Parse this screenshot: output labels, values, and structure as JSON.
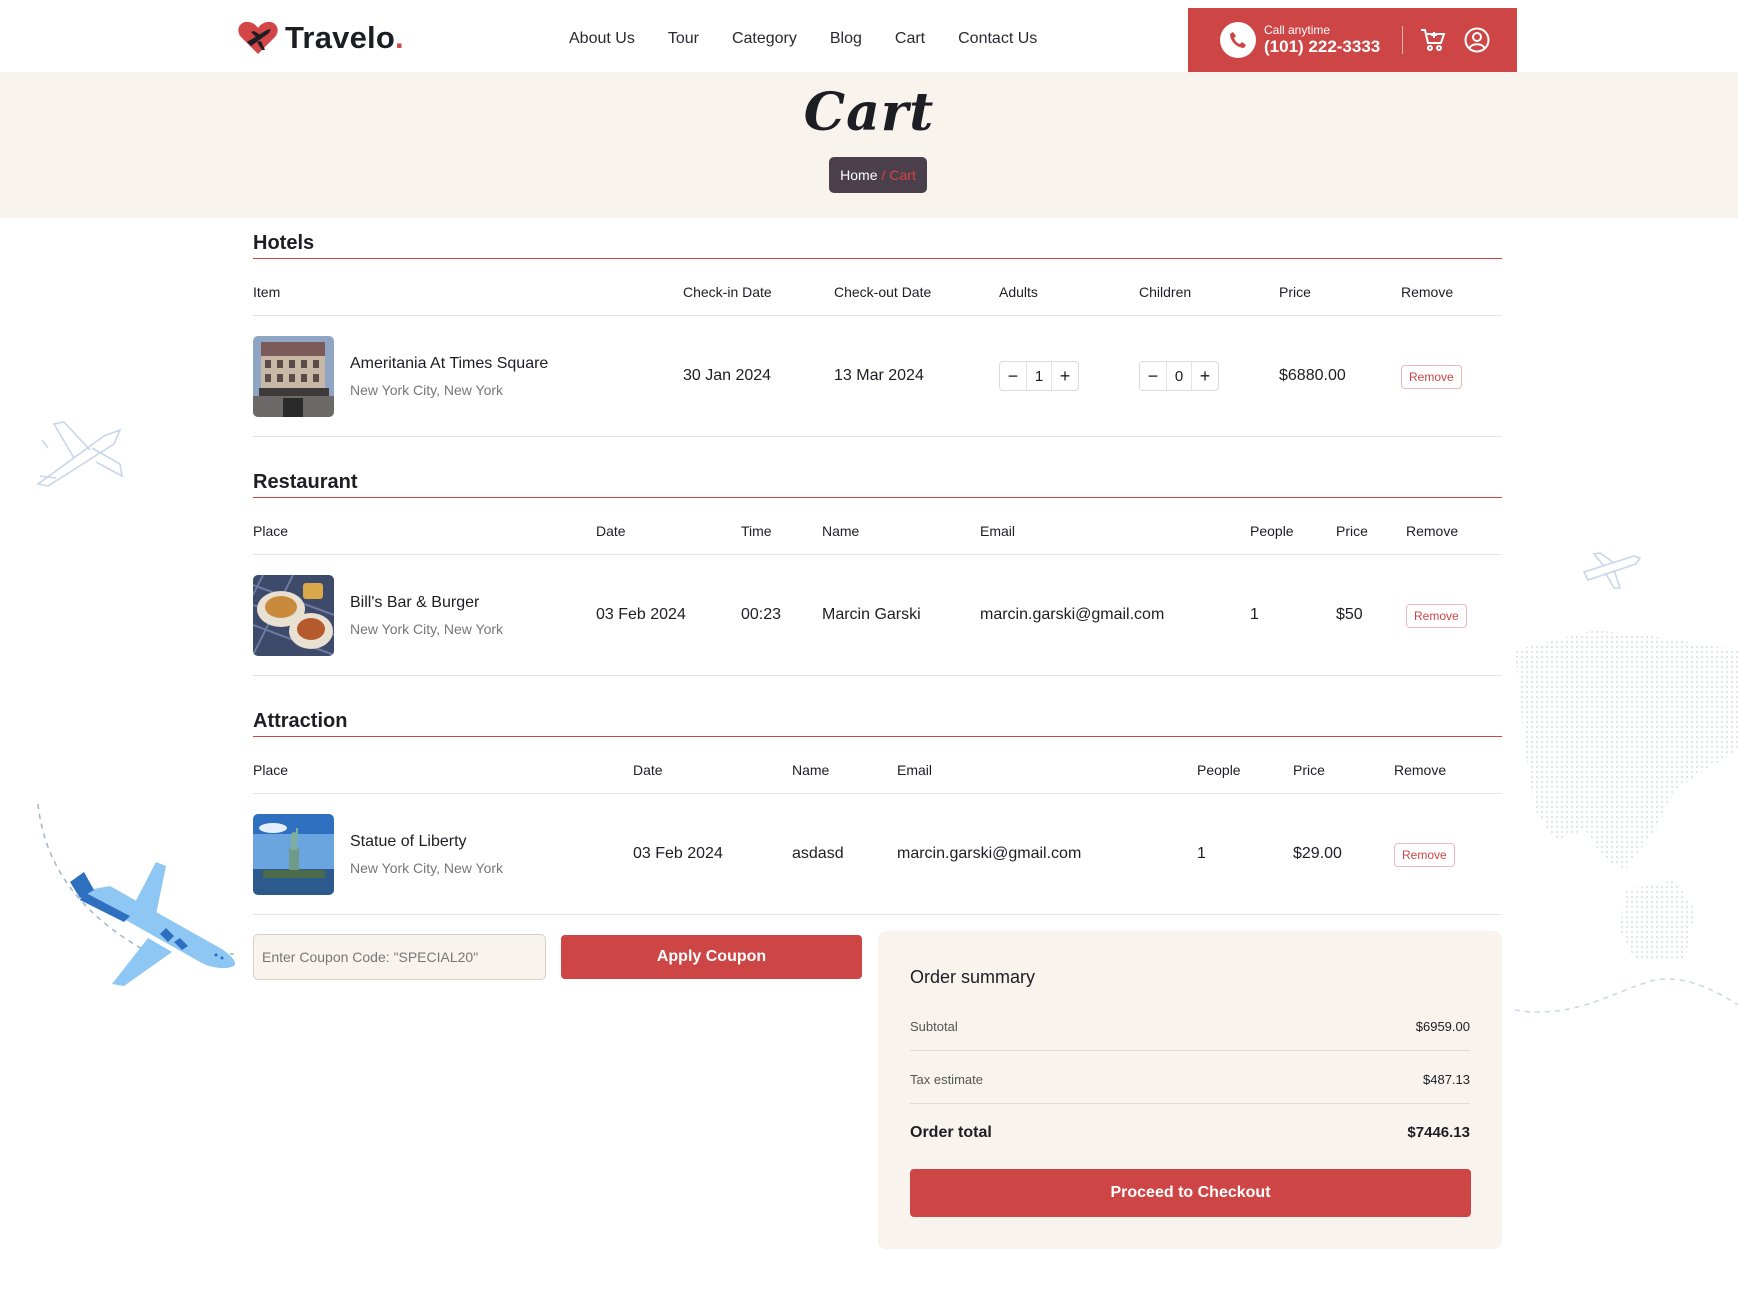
{
  "brand": {
    "name": "Travelo",
    "dot": "."
  },
  "nav": [
    "About Us",
    "Tour",
    "Category",
    "Blog",
    "Cart",
    "Contact Us"
  ],
  "call": {
    "label": "Call anytime",
    "number": "(101) 222-3333"
  },
  "banner": {
    "title": "Cart",
    "breadcrumb_home": "Home",
    "breadcrumb_sep": "/",
    "breadcrumb_current": "Cart"
  },
  "hotels": {
    "title": "Hotels",
    "headers": [
      "Item",
      "Check-in Date",
      "Check-out Date",
      "Adults",
      "Children",
      "Price",
      "Remove"
    ],
    "row": {
      "name": "Ameritania At Times Square",
      "location": "New York City, New York",
      "checkin": "30 Jan 2024",
      "checkout": "13 Mar 2024",
      "adults": "1",
      "children": "0",
      "price": "$6880.00",
      "remove": "Remove"
    }
  },
  "restaurant": {
    "title": "Restaurant",
    "headers": [
      "Place",
      "Date",
      "Time",
      "Name",
      "Email",
      "People",
      "Price",
      "Remove"
    ],
    "row": {
      "name": "Bill's Bar & Burger",
      "location": "New York City, New York",
      "date": "03 Feb 2024",
      "time": "00:23",
      "guest": "Marcin Garski",
      "email": "marcin.garski@gmail.com",
      "people": "1",
      "price": "$50",
      "remove": "Remove"
    }
  },
  "attraction": {
    "title": "Attraction",
    "headers": [
      "Place",
      "Date",
      "Name",
      "Email",
      "People",
      "Price",
      "Remove"
    ],
    "row": {
      "name": "Statue of Liberty",
      "location": "New York City, New York",
      "date": "03 Feb 2024",
      "guest": "asdasd",
      "email": "marcin.garski@gmail.com",
      "people": "1",
      "price": "$29.00",
      "remove": "Remove"
    }
  },
  "stepper": {
    "minus": "−",
    "plus": "+"
  },
  "coupon": {
    "placeholder": "Enter Coupon Code: \"SPECIAL20\"",
    "button": "Apply Coupon"
  },
  "summary": {
    "title": "Order summary",
    "subtotal_label": "Subtotal",
    "subtotal": "$6959.00",
    "tax_label": "Tax estimate",
    "tax": "$487.13",
    "total_label": "Order total",
    "total": "$7446.13",
    "checkout": "Proceed to Checkout"
  },
  "colors": {
    "accent": "#cd4545",
    "banner_bg": "#f8f3ec",
    "breadcrumb_bg": "#4a3f4a"
  },
  "icons": [
    "logo-heart-plane-icon",
    "phone-icon",
    "cart-icon",
    "user-icon",
    "plane-outline-icon",
    "plane-small-icon",
    "plane-blue-icon",
    "world-map-dots"
  ]
}
